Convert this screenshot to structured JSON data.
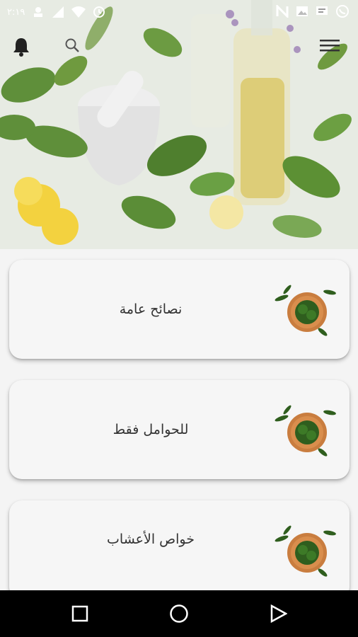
{
  "status_bar": {
    "time": "٢:١٩",
    "left_icons": [
      "person-icon",
      "signal-icon",
      "wifi-icon",
      "clock-icon"
    ],
    "right_icons": [
      "n-icon",
      "image-icon",
      "message-icon",
      "whatsapp-icon"
    ]
  },
  "toolbar": {
    "icons": [
      "bell-icon",
      "search-icon",
      "menu-icon"
    ]
  },
  "hero": {
    "description_colors": {
      "leaf": "#5f8f3a",
      "flower": "#f3d23f",
      "mortar": "#e6e6e6",
      "oil": "#d8c15a"
    }
  },
  "menu": {
    "items": [
      {
        "label": "نصائح عامة"
      },
      {
        "label": "للحوامل فقط"
      },
      {
        "label": "خواص الأعشاب"
      }
    ]
  },
  "nav_bar": {
    "icons": [
      "recents-square-icon",
      "home-circle-icon",
      "back-triangle-icon"
    ]
  }
}
